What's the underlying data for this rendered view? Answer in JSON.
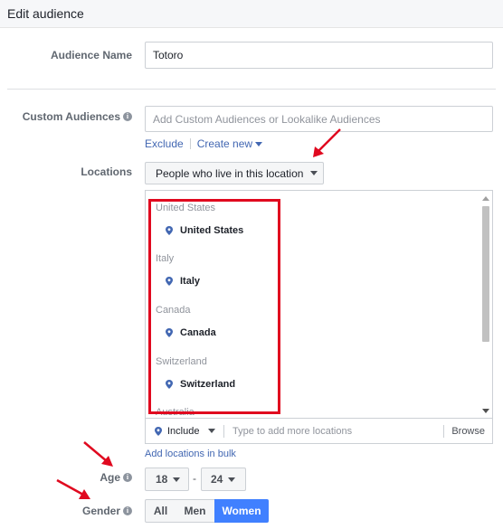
{
  "header": {
    "title": "Edit audience"
  },
  "audience_name": {
    "label": "Audience Name",
    "value": "Totoro"
  },
  "custom_audiences": {
    "label": "Custom Audiences",
    "placeholder": "Add Custom Audiences or Lookalike Audiences",
    "exclude_label": "Exclude",
    "create_new_label": "Create new"
  },
  "locations": {
    "label": "Locations",
    "dropdown_value": "People who live in this location",
    "groups": [
      {
        "group": "United States",
        "item": "United States"
      },
      {
        "group": "Italy",
        "item": "Italy"
      },
      {
        "group": "Canada",
        "item": "Canada"
      },
      {
        "group": "Switzerland",
        "item": "Switzerland"
      },
      {
        "group": "Australia",
        "item": ""
      }
    ],
    "include_label": "Include",
    "add_placeholder": "Type to add more locations",
    "browse_label": "Browse",
    "bulk_label": "Add locations in bulk"
  },
  "age": {
    "label": "Age",
    "min": "18",
    "separator": "-",
    "max": "24"
  },
  "gender": {
    "label": "Gender",
    "options": [
      "All",
      "Men",
      "Women"
    ],
    "selected": "Women"
  },
  "colors": {
    "accent": "#4267b2",
    "selected": "#4080ff",
    "highlight": "#e0091f"
  }
}
